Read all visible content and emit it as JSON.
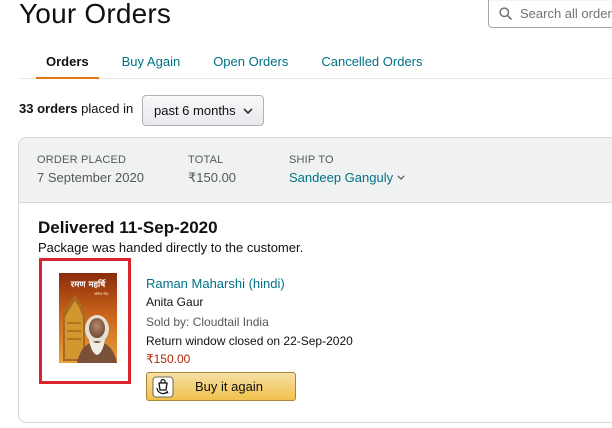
{
  "page": {
    "title": "Your Orders"
  },
  "search": {
    "placeholder": "Search all orders"
  },
  "tabs": [
    {
      "label": "Orders",
      "active": true
    },
    {
      "label": "Buy Again",
      "active": false
    },
    {
      "label": "Open Orders",
      "active": false
    },
    {
      "label": "Cancelled Orders",
      "active": false
    }
  ],
  "filter": {
    "count": "33 orders",
    "suffix": "placed in",
    "period": "past 6 months"
  },
  "order": {
    "placed_label": "ORDER PLACED",
    "placed_value": "7 September 2020",
    "total_label": "TOTAL",
    "total_value": "₹150.00",
    "ship_label": "SHIP TO",
    "ship_value": "Sandeep Ganguly",
    "status": "Delivered 11-Sep-2020",
    "status_note": "Package was handed directly to the customer.",
    "item": {
      "title": "Raman Maharshi (hindi)",
      "author": "Anita Gaur",
      "seller": "Sold by: Cloudtail India",
      "return_window": "Return window closed on 22-Sep-2020",
      "price": "₹150.00",
      "cover_text": "रमण महर्षि"
    },
    "buy_again_label": "Buy it again"
  },
  "colors": {
    "link": "#007185",
    "price": "#b12704",
    "tab_underline": "#e47911",
    "highlight": "#d9242e",
    "button": "#f0c14b"
  },
  "icons": [
    "search-icon",
    "chevron-down-icon",
    "buy-again-icon"
  ]
}
